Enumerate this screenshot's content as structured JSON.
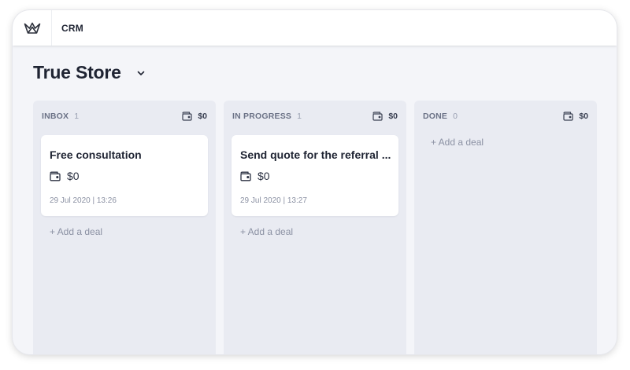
{
  "app": {
    "title": "CRM",
    "logo_icon": "crown-logo-icon"
  },
  "store": {
    "title": "True Store",
    "dropdown_icon": "chevron-down-icon"
  },
  "columns": [
    {
      "name": "INBOX",
      "count": "1",
      "total": "$0",
      "add_label": "+ Add a deal",
      "deals": [
        {
          "title": "Free consultation",
          "amount": "$0",
          "date": "29 Jul 2020 | 13:26"
        }
      ]
    },
    {
      "name": "IN PROGRESS",
      "count": "1",
      "total": "$0",
      "add_label": "+ Add a deal",
      "deals": [
        {
          "title": "Send quote for the referral ...",
          "amount": "$0",
          "date": "29 Jul 2020 | 13:27"
        }
      ]
    },
    {
      "name": "DONE",
      "count": "0",
      "total": "$0",
      "add_label": "+ Add a deal",
      "deals": []
    }
  ],
  "colors": {
    "background": "#f4f5f9",
    "column": "#e9ebf2",
    "card": "#ffffff",
    "text": "#1f2433",
    "muted": "#8b91a3"
  }
}
